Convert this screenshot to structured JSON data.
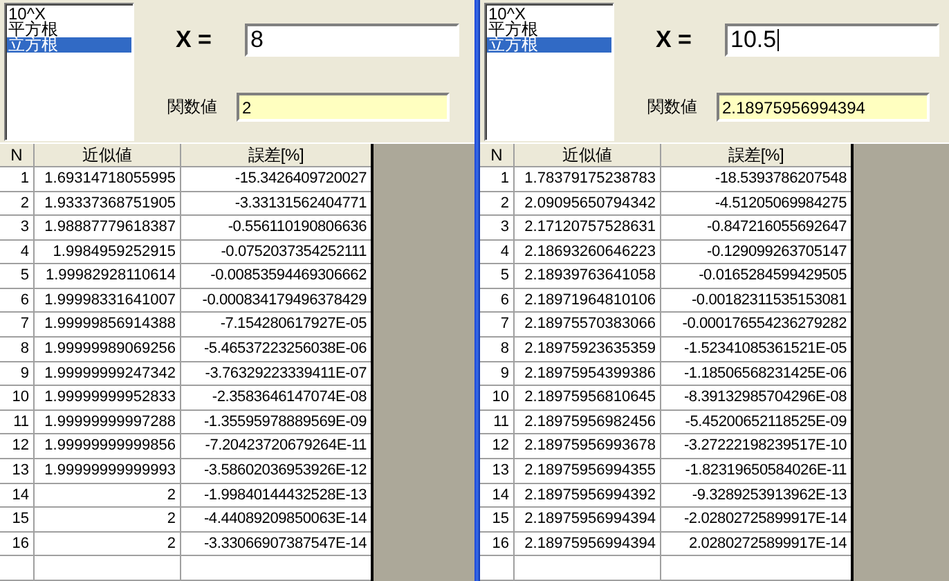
{
  "panels": [
    {
      "list": [
        {
          "label": "10^X",
          "selected": false
        },
        {
          "label": "平方根",
          "selected": false
        },
        {
          "label": "立方根",
          "selected": true
        }
      ],
      "x_label": "X =",
      "x_value": "8",
      "x_focused": false,
      "result_label": "関数値",
      "result_value": "2",
      "table": {
        "columns": [
          "N",
          "近似値",
          "誤差[%]"
        ],
        "rows": [
          [
            "1",
            "1.69314718055995",
            "-15.3426409720027"
          ],
          [
            "2",
            "1.93337368751905",
            "-3.33131562404771"
          ],
          [
            "3",
            "1.98887779618387",
            "-0.556110190806636"
          ],
          [
            "4",
            "1.9984959252915",
            "-0.0752037354252111"
          ],
          [
            "5",
            "1.99982928110614",
            "-0.00853594469306662"
          ],
          [
            "6",
            "1.99998331641007",
            "-0.000834179496378429"
          ],
          [
            "7",
            "1.99999856914388",
            "-7.154280617927E-05"
          ],
          [
            "8",
            "1.99999989069256",
            "-5.46537223256038E-06"
          ],
          [
            "9",
            "1.99999999247342",
            "-3.76329223339411E-07"
          ],
          [
            "10",
            "1.99999999952833",
            "-2.3583646147074E-08"
          ],
          [
            "11",
            "1.99999999997288",
            "-1.35595978889569E-09"
          ],
          [
            "12",
            "1.99999999999856",
            "-7.20423720679264E-11"
          ],
          [
            "13",
            "1.99999999999993",
            "-3.58602036953926E-12"
          ],
          [
            "14",
            "2",
            "-1.99840144432528E-13"
          ],
          [
            "15",
            "2",
            "-4.44089209850063E-14"
          ],
          [
            "16",
            "2",
            "-3.33066907387547E-14"
          ]
        ]
      }
    },
    {
      "list": [
        {
          "label": "10^X",
          "selected": false
        },
        {
          "label": "平方根",
          "selected": false
        },
        {
          "label": "立方根",
          "selected": true
        }
      ],
      "x_label": "X =",
      "x_value": "10.5",
      "x_focused": true,
      "result_label": "関数値",
      "result_value": "2.18975956994394",
      "table": {
        "columns": [
          "N",
          "近似値",
          "誤差[%]"
        ],
        "rows": [
          [
            "1",
            "1.78379175238783",
            "-18.5393786207548"
          ],
          [
            "2",
            "2.09095650794342",
            "-4.51205069984275"
          ],
          [
            "3",
            "2.17120757528631",
            "-0.847216055692647"
          ],
          [
            "4",
            "2.18693260646223",
            "-0.129099263705147"
          ],
          [
            "5",
            "2.18939763641058",
            "-0.0165284599429505"
          ],
          [
            "6",
            "2.18971964810106",
            "-0.00182311535153081"
          ],
          [
            "7",
            "2.18975570383066",
            "-0.000176554236279282"
          ],
          [
            "8",
            "2.18975923635359",
            "-1.52341085361521E-05"
          ],
          [
            "9",
            "2.18975954399386",
            "-1.18506568231425E-06"
          ],
          [
            "10",
            "2.18975956810645",
            "-8.39132985704296E-08"
          ],
          [
            "11",
            "2.18975956982456",
            "-5.45200652118525E-09"
          ],
          [
            "12",
            "2.18975956993678",
            "-3.27222198239517E-10"
          ],
          [
            "13",
            "2.18975956994355",
            "-1.82319650584026E-11"
          ],
          [
            "14",
            "2.18975956994392",
            "-9.3289253913962E-13"
          ],
          [
            "15",
            "2.18975956994394",
            "-2.02802725899917E-14"
          ],
          [
            "16",
            "2.18975956994394",
            "2.02802725899917E-14"
          ]
        ]
      }
    }
  ]
}
